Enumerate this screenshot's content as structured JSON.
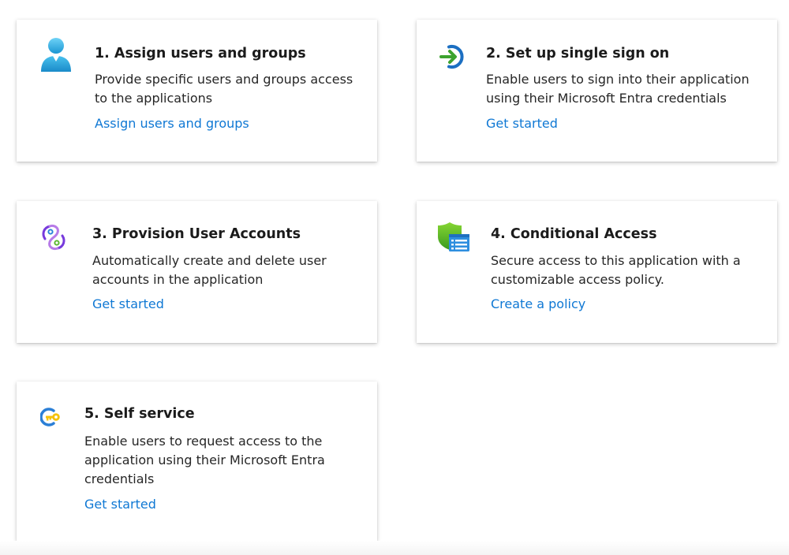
{
  "colors": {
    "link": "#0f78d4",
    "title": "#1b1b1b",
    "body_text": "#262626",
    "card_background": "#ffffff"
  },
  "cards": [
    {
      "title": "1. Assign users and groups",
      "description": "Provide specific users and groups access to the applications",
      "link": "Assign users and groups",
      "icon": "user-icon"
    },
    {
      "title": "2. Set up single sign on",
      "description": "Enable users to sign into their application using their Microsoft Entra credentials",
      "link": "Get started",
      "icon": "sign-in-arrow-icon"
    },
    {
      "title": "3. Provision User Accounts",
      "description": "Automatically create and delete user accounts in the application",
      "link": "Get started",
      "icon": "provisioning-icon"
    },
    {
      "title": "4. Conditional Access",
      "description": "Secure access to this application with a customizable access policy.",
      "link": "Create a policy",
      "icon": "shield-policy-icon"
    },
    {
      "title": "5. Self service",
      "description": "Enable users to request access to the application using their Microsoft Entra credentials",
      "link": "Get started",
      "icon": "key-icon"
    }
  ]
}
